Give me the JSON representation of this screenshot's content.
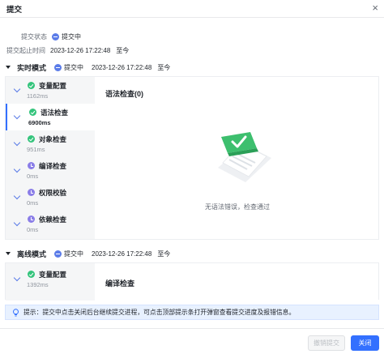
{
  "dialog": {
    "title": "提交",
    "close_glyph": "×"
  },
  "summary": {
    "status_label": "提交状态",
    "status_value": "提交中",
    "time_label": "提交起止时间",
    "time_start": "2023-12-26 17:22:48",
    "time_to": "至今"
  },
  "realtime": {
    "name": "实时模式",
    "status": "提交中",
    "time_start": "2023-12-26 17:22:48",
    "time_to": "至今",
    "steps": [
      {
        "name": "变量配置",
        "duration": "1162ms",
        "state": "ok"
      },
      {
        "name": "语法检查",
        "duration": "6900ms",
        "state": "ok"
      },
      {
        "name": "对象检查",
        "duration": "951ms",
        "state": "ok"
      },
      {
        "name": "编译检查",
        "duration": "0ms",
        "state": "wait"
      },
      {
        "name": "权限校验",
        "duration": "0ms",
        "state": "wait"
      },
      {
        "name": "依赖检查",
        "duration": "0ms",
        "state": "wait"
      }
    ],
    "active_step": 1,
    "content_heading": "语法检查(0)",
    "empty_message": "无语法错误，检查通过"
  },
  "offline": {
    "name": "离线模式",
    "status": "提交中",
    "time_start": "2023-12-26 17:22:48",
    "time_to": "至今",
    "steps": [
      {
        "name": "变量配置",
        "duration": "1392ms",
        "state": "ok"
      }
    ],
    "content_heading": "编译检查"
  },
  "tip": {
    "text": "提示：提交中点击关闭后台继续提交进程，可点击顶部提示条打开弹窗查看提交进度及报错信息。"
  },
  "footer": {
    "cancel_label": "撤销提交",
    "close_label": "关闭"
  },
  "colors": {
    "primary": "#3370ff",
    "success": "#34c47c",
    "pending": "#8b7ee8",
    "status_dot": "#5b7ce8"
  }
}
